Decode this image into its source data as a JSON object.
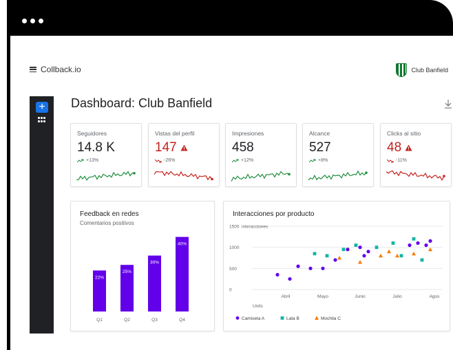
{
  "app": {
    "brand": "Collback.io",
    "club_name": "Club Banfield"
  },
  "page": {
    "title": "Dashboard: Club Banfield"
  },
  "colors": {
    "accent": "#1a73e8",
    "good": "#1e8e3e",
    "bad": "#c5221f",
    "purple": "#6200ea",
    "teal": "#12b5a6",
    "orange": "#f57c00"
  },
  "kpis": [
    {
      "label": "Seguidores",
      "value": "14.8 K",
      "delta": "+13%",
      "trend": "up"
    },
    {
      "label": "Vistas del perfil",
      "value": "147",
      "delta": "-26%",
      "trend": "down"
    },
    {
      "label": "Impresiones",
      "value": "458",
      "delta": "+12%",
      "trend": "up"
    },
    {
      "label": "Alcance",
      "value": "527",
      "delta": "+8%",
      "trend": "up"
    },
    {
      "label": "Clicks al sitio",
      "value": "48",
      "delta": "-11%",
      "trend": "down"
    }
  ],
  "feedback": {
    "title": "Feedback en redes",
    "subtitle": "Comentarios positivos"
  },
  "interacciones": {
    "title": "Interacciones por producto"
  },
  "chart_data": [
    {
      "type": "bar",
      "title": "Feedback en redes",
      "subtitle": "Comentarios positivos",
      "categories": [
        "Q1",
        "Q2",
        "Q3",
        "Q4"
      ],
      "values": [
        22,
        25,
        30,
        40
      ],
      "data_labels": [
        "22%",
        "25%",
        "30%",
        "40%"
      ],
      "ylim": [
        0,
        45
      ]
    },
    {
      "type": "scatter",
      "title": "Interacciones por producto",
      "ylabel": "interacciones",
      "xlabel": "Units",
      "x_ticks": [
        "Abril",
        "Mayo",
        "Junio",
        "Julio",
        "Agos"
      ],
      "y_ticks": [
        "0",
        "500",
        "1000",
        "1500"
      ],
      "ylim": [
        0,
        1500
      ],
      "grid": true,
      "legend": "bottom-left",
      "series": [
        {
          "name": "Camiseta A",
          "color": "#6200ea",
          "marker": "circle",
          "points": [
            [
              1.1,
              350
            ],
            [
              1.4,
              250
            ],
            [
              1.6,
              550
            ],
            [
              1.9,
              500
            ],
            [
              2.2,
              500
            ],
            [
              2.5,
              700
            ],
            [
              2.8,
              950
            ],
            [
              3.1,
              1000
            ],
            [
              3.2,
              800
            ],
            [
              3.3,
              900
            ],
            [
              4.3,
              1050
            ],
            [
              4.5,
              1100
            ],
            [
              4.7,
              1050
            ],
            [
              4.8,
              1150
            ]
          ]
        },
        {
          "name": "Lata B",
          "color": "#12b5a6",
          "marker": "square",
          "points": [
            [
              2.0,
              850
            ],
            [
              2.3,
              800
            ],
            [
              2.7,
              950
            ],
            [
              3.0,
              1050
            ],
            [
              3.5,
              1000
            ],
            [
              3.9,
              1100
            ],
            [
              4.1,
              800
            ],
            [
              4.4,
              1200
            ],
            [
              4.6,
              700
            ]
          ]
        },
        {
          "name": "Mochila C",
          "color": "#f57c00",
          "marker": "triangle",
          "points": [
            [
              2.6,
              750
            ],
            [
              3.1,
              650
            ],
            [
              3.6,
              800
            ],
            [
              3.8,
              900
            ],
            [
              4.0,
              800
            ],
            [
              4.4,
              850
            ],
            [
              4.8,
              950
            ]
          ]
        }
      ]
    }
  ]
}
